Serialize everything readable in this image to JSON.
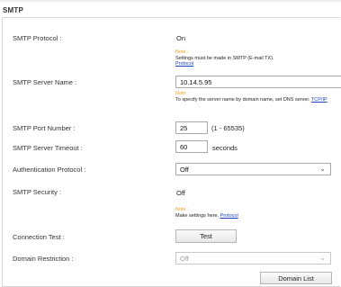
{
  "section_title": "SMTP",
  "smtp_protocol": {
    "label": "SMTP Protocol :",
    "value": "On",
    "note": {
      "heading": "Note :",
      "text": "Settings must be made in SMTP (E-mail TX).",
      "link": "Protocol"
    }
  },
  "smtp_server_name": {
    "label": "SMTP Server Name :",
    "value": "10.14.5.95",
    "note": {
      "heading": "Note :",
      "text": "To specify the server name by domain name, set DNS server.",
      "link": "TCP/IP"
    }
  },
  "smtp_port_number": {
    "label": "SMTP Port Number :",
    "value": "25",
    "range": "(1 - 65535)"
  },
  "smtp_server_timeout": {
    "label": "SMTP Server Timeout :",
    "value": "60",
    "unit": "seconds"
  },
  "authentication_protocol": {
    "label": "Authentication Protocol :",
    "selected": "Off"
  },
  "smtp_security": {
    "label": "SMTP Security :",
    "value": "Off",
    "note": {
      "heading": "Note :",
      "text": "Make settings here.",
      "link": "Protocol"
    }
  },
  "connection_test": {
    "label": "Connection Test :",
    "button": "Test"
  },
  "domain_restriction": {
    "label": "Domain Restriction :",
    "selected": "Off"
  },
  "domain_list_button": "Domain List"
}
